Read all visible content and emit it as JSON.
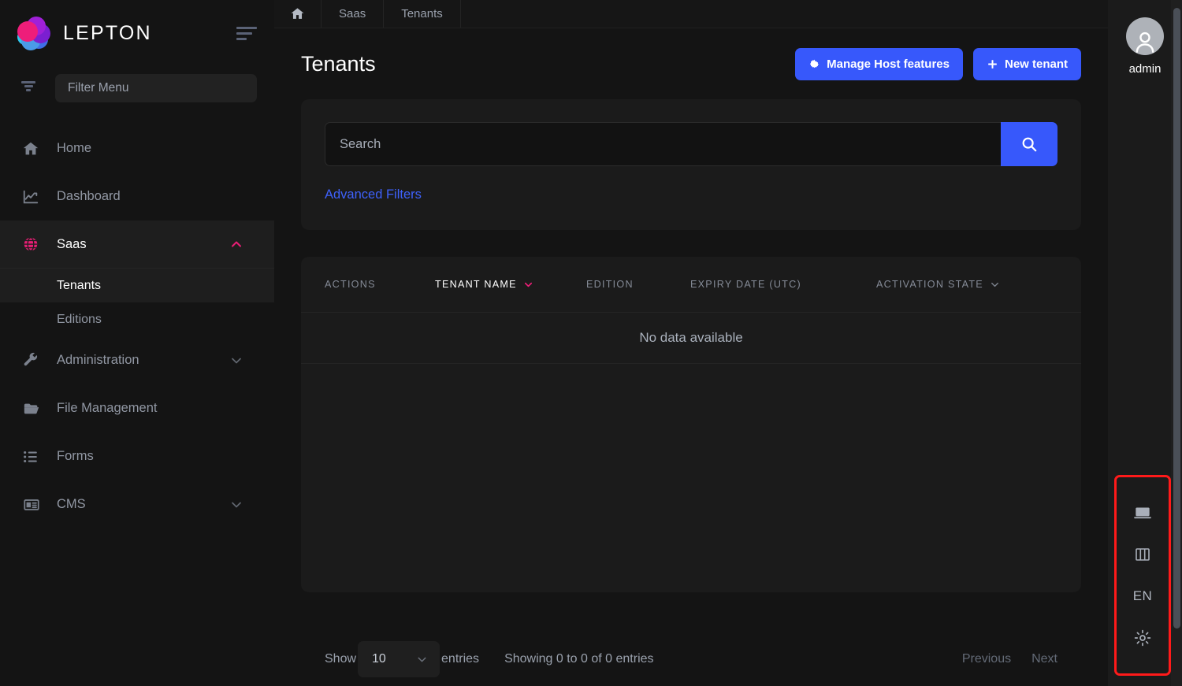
{
  "brand": {
    "name": "LEPTON",
    "logo_icon": "lepton-flower-logo",
    "collapse_icon": "menu-collapse-icon"
  },
  "sidebar": {
    "filter": {
      "placeholder": "Filter Menu",
      "value": "",
      "icon": "funnel-filter-icon"
    },
    "items": [
      {
        "label": "Home",
        "icon": "home-icon",
        "state": "default",
        "expandable": false
      },
      {
        "label": "Dashboard",
        "icon": "chart-line-icon",
        "state": "default",
        "expandable": false
      },
      {
        "label": "Saas",
        "icon": "globe-icon",
        "state": "open",
        "expandable": true,
        "chevron": "chevron-up-icon"
      },
      {
        "label": "Administration",
        "icon": "wrench-icon",
        "state": "default",
        "expandable": true,
        "chevron": "chevron-down-icon"
      },
      {
        "label": "File Management",
        "icon": "folder-open-icon",
        "state": "default",
        "expandable": false
      },
      {
        "label": "Forms",
        "icon": "list-icon",
        "state": "default",
        "expandable": false
      },
      {
        "label": "CMS",
        "icon": "newspaper-icon",
        "state": "default",
        "expandable": true,
        "chevron": "chevron-down-icon"
      }
    ],
    "saas_children": [
      {
        "label": "Tenants",
        "active": true
      },
      {
        "label": "Editions",
        "active": false
      }
    ]
  },
  "breadcrumb": {
    "home_icon": "home-icon",
    "items": [
      {
        "label": "Saas"
      },
      {
        "label": "Tenants"
      }
    ]
  },
  "page": {
    "title": "Tenants",
    "buttons": [
      {
        "label": "Manage Host features",
        "icon": "gear-icon"
      },
      {
        "label": "New tenant",
        "icon": "plus-icon"
      }
    ]
  },
  "search": {
    "placeholder": "Search",
    "value": "",
    "button_icon": "search-icon",
    "advanced_filters_label": "Advanced Filters"
  },
  "table": {
    "columns": [
      {
        "label": "ACTIONS",
        "sortable": false,
        "sorted": false
      },
      {
        "label": "TENANT NAME",
        "sortable": true,
        "sorted": true,
        "chevron": "chevron-down-icon"
      },
      {
        "label": "EDITION",
        "sortable": false,
        "sorted": false
      },
      {
        "label": "EXPIRY DATE (UTC)",
        "sortable": false,
        "sorted": false
      },
      {
        "label": "ACTIVATION STATE",
        "sortable": true,
        "sorted": false,
        "chevron": "chevron-down-icon"
      }
    ],
    "rows": [],
    "empty_message": "No data available"
  },
  "pagination": {
    "show_label": "Show",
    "page_size": "10",
    "entries_label": "entries",
    "showing_text": "Showing 0 to 0 of 0 entries",
    "previous_label": "Previous",
    "next_label": "Next",
    "dropdown_icon": "chevron-down-icon"
  },
  "user": {
    "name": "admin",
    "avatar_icon": "user-avatar-icon"
  },
  "rail_tools": [
    {
      "icon": "laptop-icon",
      "label": ""
    },
    {
      "icon": "columns-layout-icon",
      "label": ""
    },
    {
      "icon": "language-icon",
      "label": "EN"
    },
    {
      "icon": "gear-icon",
      "label": ""
    }
  ],
  "colors": {
    "accent_blue": "#3758FB",
    "accent_pink": "#E91E75",
    "page_bg": "#141414",
    "card_bg": "#1B1B1B",
    "highlight_border": "#FF1A1A"
  }
}
